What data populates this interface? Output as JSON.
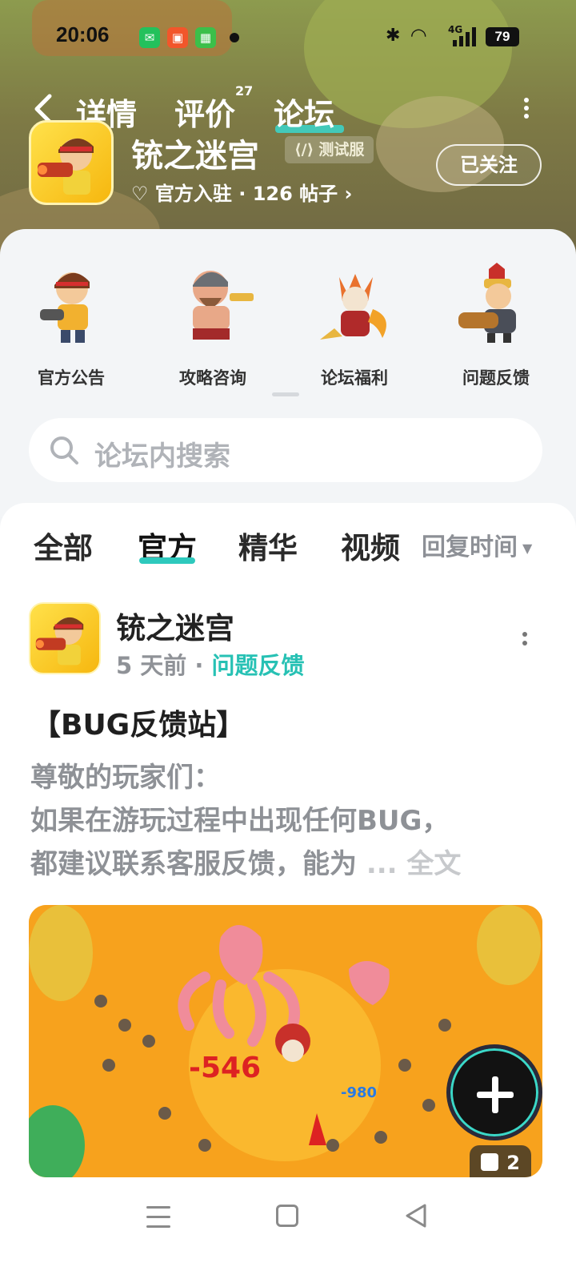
{
  "status_bar": {
    "time": "20:06",
    "signal_label": "4G",
    "battery": "79"
  },
  "nav": {
    "tabs": [
      {
        "label": "详情"
      },
      {
        "label": "评价",
        "badge": "27"
      },
      {
        "label": "论坛"
      }
    ],
    "active_tab": "论坛"
  },
  "game": {
    "title": "铳之迷宫",
    "tag": "测试服",
    "meta": "官方入驻 · 126 帖子",
    "follow_label": "已关注"
  },
  "categories": [
    {
      "label": "官方公告",
      "icon": "character-gunner-icon"
    },
    {
      "label": "攻略咨询",
      "icon": "character-warrior-icon"
    },
    {
      "label": "论坛福利",
      "icon": "character-demon-icon"
    },
    {
      "label": "问题反馈",
      "icon": "character-cannoneer-icon"
    }
  ],
  "search": {
    "placeholder": "论坛内搜索"
  },
  "feed": {
    "tabs": [
      "全部",
      "官方",
      "精华",
      "视频"
    ],
    "active_tab": "官方",
    "sort_label": "回复时间"
  },
  "post": {
    "author": "铳之迷宫",
    "time": "5 天前",
    "separator": "·",
    "category": "问题反馈",
    "title": "【BUG反馈站】",
    "body_lines": [
      "尊敬的玩家们：",
      " 如果在游玩过程中出现任何BUG，",
      "都建议联系客服反馈，能为"
    ],
    "ellipsis": " ... ",
    "read_more": "全文",
    "image_count": "2"
  },
  "colors": {
    "accent": "#2ec9bd",
    "banner": "#8d9b4e"
  }
}
